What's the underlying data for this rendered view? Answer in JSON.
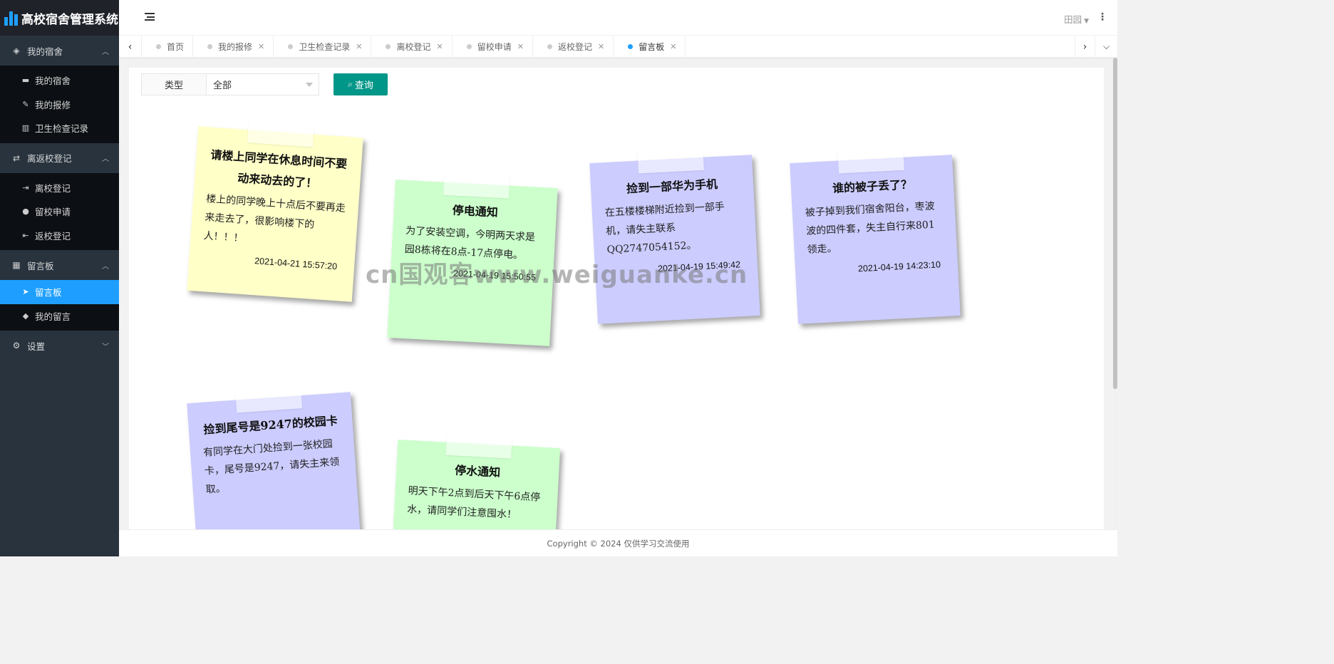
{
  "app": {
    "title": "高校宿舍管理系统",
    "logo_icon": "building-icon"
  },
  "sidebar": {
    "groups": [
      {
        "label": "我的宿舍",
        "icon": "cube-icon",
        "expanded": true,
        "items": [
          {
            "label": "我的宿舍",
            "icon": "bed-icon"
          },
          {
            "label": "我的报修",
            "icon": "wrench-icon"
          },
          {
            "label": "卫生检查记录",
            "icon": "bar-chart-icon"
          }
        ]
      },
      {
        "label": "离返校登记",
        "icon": "exchange-icon",
        "expanded": true,
        "items": [
          {
            "label": "离校登记",
            "icon": "sign-out-icon"
          },
          {
            "label": "留校申请",
            "icon": "globe-icon"
          },
          {
            "label": "返校登记",
            "icon": "sign-in-icon"
          }
        ]
      },
      {
        "label": "留言板",
        "icon": "calendar-icon",
        "expanded": true,
        "items": [
          {
            "label": "留言板",
            "icon": "send-icon",
            "active": true
          },
          {
            "label": "我的留言",
            "icon": "tags-icon"
          }
        ]
      },
      {
        "label": "设置",
        "icon": "gear-icon",
        "expanded": false,
        "items": []
      }
    ]
  },
  "header": {
    "user": "田园",
    "menu_icon": "menu-fold-icon"
  },
  "tabs": [
    {
      "label": "首页",
      "closable": false,
      "active": false
    },
    {
      "label": "我的报修",
      "closable": true,
      "active": false
    },
    {
      "label": "卫生检查记录",
      "closable": true,
      "active": false
    },
    {
      "label": "离校登记",
      "closable": true,
      "active": false
    },
    {
      "label": "留校申请",
      "closable": true,
      "active": false
    },
    {
      "label": "返校登记",
      "closable": true,
      "active": false
    },
    {
      "label": "留言板",
      "closable": true,
      "active": true
    }
  ],
  "search": {
    "label": "类型",
    "selected": "全部",
    "button": "查询"
  },
  "notes": [
    {
      "color": "yellow",
      "title": "请楼上同学在休息时间不要动来动去的了！",
      "body": "楼上的同学晚上十点后不要再走来走去了，很影响楼下的人！！！",
      "time": "2021-04-21 15:57:20"
    },
    {
      "color": "green",
      "title": "停电通知",
      "body": "为了安装空调，今明两天求是园8栋将在8点-17点停电。",
      "time": "2021-04-19 15:50:55"
    },
    {
      "color": "purple",
      "title": "捡到一部华为手机",
      "body": "在五楼楼梯附近捡到一部手机，请失主联系QQ2747054152。",
      "time": "2021-04-19 15:49:42"
    },
    {
      "color": "purple",
      "title": "谁的被子丢了？",
      "body": "被子掉到我们宿舍阳台，枣波波的四件套，失主自行来801领走。",
      "time": "2021-04-19 14:23:10"
    },
    {
      "color": "purple",
      "title": "捡到尾号是9247的校园卡",
      "body": "有同学在大门处捡到一张校园卡，尾号是9247，请失主来领取。",
      "time": ""
    },
    {
      "color": "green",
      "title": "停水通知",
      "body": "明天下午2点到后天下午6点停水，请同学们注意囤水！",
      "time": ""
    }
  ],
  "watermark": "cn国观客www.weiguanke.cn",
  "footer": {
    "text": "Copyright © 2024 仅供学习交流使用"
  },
  "colors": {
    "sidebar_bg": "#28333e",
    "active": "#1e9fff",
    "search_button": "#009688"
  }
}
